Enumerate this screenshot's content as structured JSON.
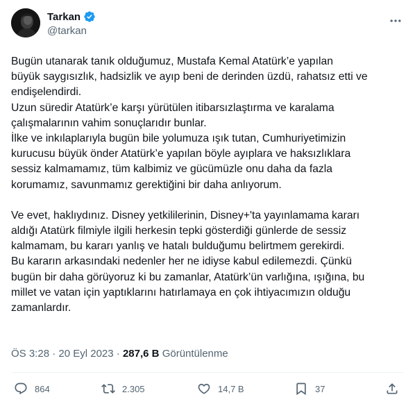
{
  "author": {
    "display_name": "Tarkan",
    "handle": "@tarkan",
    "verified": true
  },
  "tweet": {
    "paragraph_1": "Bugün utanarak tanık olduğumuz, Mustafa Kemal Atatürk’e yapılan\nbüyük saygısızlık, hadsizlik ve ayıp beni de derinden üzdü, rahatsız etti ve\nendişelendirdi.\nUzun süredir Atatürk’e karşı yürütülen itibarsızlaştırma ve karalama\nçalışmalarının vahim sonuçlarıdır bunlar.\nİlke ve inkılaplarıyla bugün bile yolumuza ışık tutan, Cumhuriyetimizin\nkurucusu büyük önder Atatürk’e yapılan böyle ayıplara ve haksızlıklara\nsessiz kalmamamız, tüm kalbimiz ve gücümüzle onu daha da fazla\nkorumamız, savunmamız gerektiğini bir daha anlıyorum.",
    "paragraph_2": "Ve evet, haklıydınız. Disney yetkililerinin, Disney+'ta yayınlamama kararı\naldığı Atatürk filmiyle ilgili herkesin tepki gösterdiği günlerde de sessiz\nkalmamam, bu kararı yanlış ve hatalı bulduğumu belirtmem gerekirdi.\nBu kararın arkasındaki nedenler her ne idiyse kabul edilemezdi. Çünkü\nbugün bir daha görüyoruz ki bu zamanlar, Atatürk’ün varlığına, ışığına, bu\nmillet ve vatan için yaptıklarını hatırlamaya en çok ihtiyacımızın olduğu\nzamanlardır."
  },
  "meta": {
    "time": "ÖS 3:28",
    "separator": " · ",
    "date": "20 Eyl 2023",
    "views_count": "287,6 B",
    "views_label": "Görüntülenme"
  },
  "actions": {
    "replies": "864",
    "retweets": "2.305",
    "likes": "14,7 B",
    "bookmarks": "37"
  },
  "colors": {
    "verified_blue": "#1d9bf0",
    "text_primary": "#0f1419",
    "text_secondary": "#536471"
  },
  "icons": {
    "more": "more-horizontal-icon",
    "reply": "reply-bubble-icon",
    "retweet": "retweet-icon",
    "like": "heart-icon",
    "bookmark": "bookmark-icon",
    "share": "share-icon"
  }
}
